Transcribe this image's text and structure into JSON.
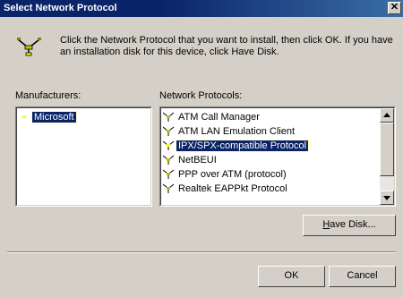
{
  "window": {
    "title": "Select Network Protocol",
    "close_glyph": "✕"
  },
  "intro": {
    "icon": "network-protocol-icon",
    "text": "Click the Network Protocol that you want to install, then click OK. If you have an installation disk for this device, click Have Disk."
  },
  "manufacturers": {
    "label": "Manufacturers:",
    "items": [
      {
        "label": "Microsoft",
        "selected": true
      }
    ]
  },
  "protocols": {
    "label": "Network Protocols:",
    "items": [
      {
        "label": "ATM Call Manager",
        "selected": false
      },
      {
        "label": "ATM LAN Emulation Client",
        "selected": false
      },
      {
        "label": "IPX/SPX-compatible Protocol",
        "selected": true
      },
      {
        "label": "NetBEUI",
        "selected": false
      },
      {
        "label": "PPP over ATM (protocol)",
        "selected": false
      },
      {
        "label": "Realtek EAPPkt Protocol",
        "selected": false
      }
    ]
  },
  "buttons": {
    "have_disk_prefix": "",
    "have_disk_mnemonic": "H",
    "have_disk_rest": "ave Disk...",
    "ok": "OK",
    "cancel": "Cancel"
  },
  "colors": {
    "selection": "#0a246a",
    "titlebar": "#0a246a",
    "face": "#d4d0c8"
  }
}
